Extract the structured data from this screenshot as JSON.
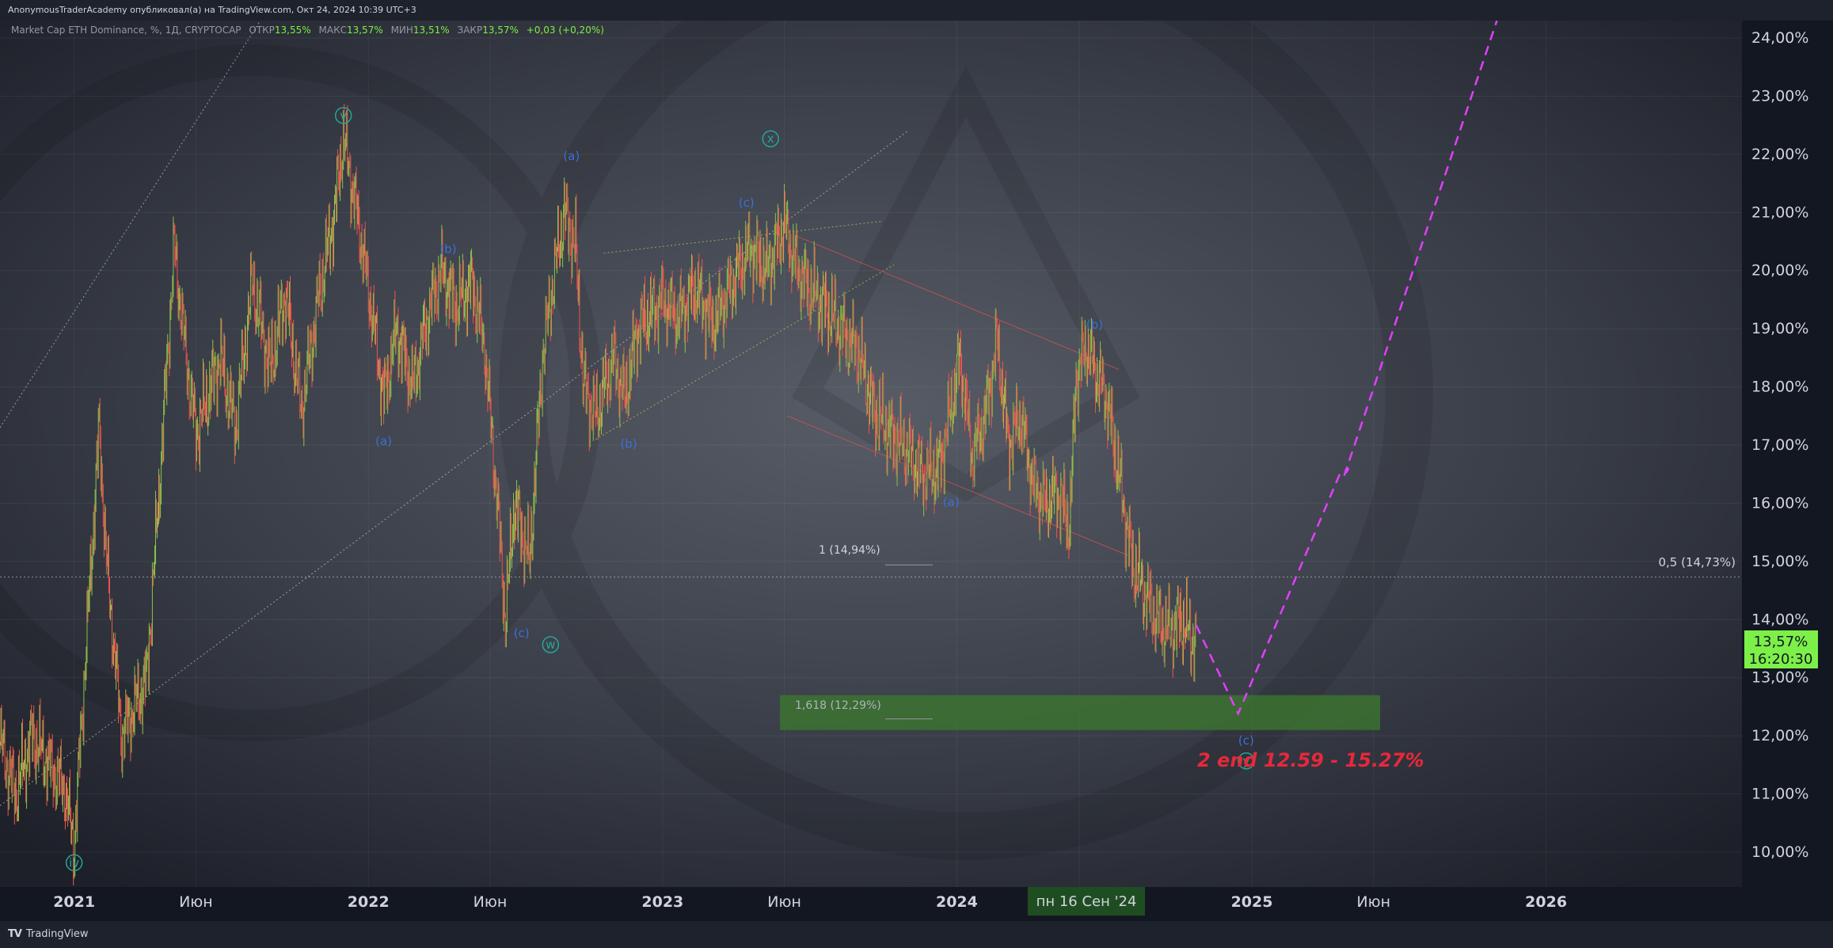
{
  "header": {
    "text": "AnonymousTraderAcademy опубликовал(а) на TradingView.com, Окт 24, 2024 10:39 UTC+3"
  },
  "legend": {
    "symbol": "Market Cap ETH Dominance, %, 1Д, CRYPTOCAP",
    "open_label": "ОТКР",
    "open_value": "13,55%",
    "high_label": "МАКС",
    "high_value": "13,57%",
    "low_label": "МИН",
    "low_value": "13,51%",
    "close_label": "ЗАКР",
    "close_value": "13,57%",
    "change": "+0,03 (+0,20%)"
  },
  "price_tag": {
    "value": "13,57%",
    "countdown": "16:20:30"
  },
  "crosshair_date": "пн 16 Сен '24",
  "fib_levels": [
    {
      "label": "1 (14,94%)",
      "value": 14.94
    },
    {
      "label": "1,618 (12,29%)",
      "value": 12.29
    },
    {
      "label": "0,5 (14,73%)",
      "value": 14.73
    }
  ],
  "target_zone": {
    "low": 12.1,
    "high": 12.7
  },
  "annotation": "2 end 12.59 - 15.27%",
  "wave_labels": [
    {
      "text": "v",
      "x": "2021-12-01",
      "y": 22.6,
      "circle": true,
      "color": "#26a69a"
    },
    {
      "text": "iv",
      "x": "2021-01-01",
      "y": 9.75,
      "circle": true,
      "color": "#26a69a"
    },
    {
      "text": "w",
      "x": "2022-08-15",
      "y": 13.5,
      "circle": true,
      "color": "#26a69a"
    },
    {
      "text": "x",
      "x": "2023-05-15",
      "y": 22.2,
      "circle": true,
      "color": "#26a69a"
    },
    {
      "text": "y",
      "x": "2024-12-25",
      "y": 11.5,
      "circle": true,
      "color": "#26a69a"
    },
    {
      "text": "(a)",
      "x": "2022-01-20",
      "y": 17.0,
      "circle": false,
      "color": "#3c6fd6"
    },
    {
      "text": "(b)",
      "x": "2022-04-10",
      "y": 20.3,
      "circle": false,
      "color": "#3c6fd6"
    },
    {
      "text": "(c)",
      "x": "2022-07-10",
      "y": 13.7,
      "circle": false,
      "color": "#3c6fd6"
    },
    {
      "text": "(a)",
      "x": "2022-09-10",
      "y": 21.9,
      "circle": false,
      "color": "#3c6fd6"
    },
    {
      "text": "(b)",
      "x": "2022-11-20",
      "y": 16.95,
      "circle": false,
      "color": "#3c6fd6"
    },
    {
      "text": "(c)",
      "x": "2023-04-15",
      "y": 21.1,
      "circle": false,
      "color": "#3c6fd6"
    },
    {
      "text": "(a)",
      "x": "2023-12-25",
      "y": 15.95,
      "circle": false,
      "color": "#3c6fd6"
    },
    {
      "text": "(b)",
      "x": "2024-06-20",
      "y": 19.0,
      "circle": false,
      "color": "#3c6fd6"
    },
    {
      "text": "(c)",
      "x": "2024-12-25",
      "y": 11.85,
      "circle": false,
      "color": "#3c6fd6"
    }
  ],
  "chart_data": {
    "type": "candlestick",
    "title": "Market Cap ETH Dominance, %, 1Д, CRYPTOCAP",
    "ylim": [
      9.4,
      24.3
    ],
    "xlim": [
      "2020-10-01",
      "2026-09-01"
    ],
    "y_ticks": [
      "10,00%",
      "11,00%",
      "12,00%",
      "13,00%",
      "14,00%",
      "15,00%",
      "16,00%",
      "17,00%",
      "18,00%",
      "19,00%",
      "20,00%",
      "21,00%",
      "22,00%",
      "23,00%",
      "24,00%"
    ],
    "x_ticks": [
      {
        "label": "2021",
        "x": "2021-01-01"
      },
      {
        "label": "Июн",
        "x": "2021-06-01"
      },
      {
        "label": "2022",
        "x": "2022-01-01"
      },
      {
        "label": "Июн",
        "x": "2022-06-01"
      },
      {
        "label": "2023",
        "x": "2023-01-01"
      },
      {
        "label": "Июн",
        "x": "2023-06-01"
      },
      {
        "label": "2024",
        "x": "2024-01-01"
      },
      {
        "label": "Июн",
        "x": "2024-06-01"
      },
      {
        "label": "2025",
        "x": "2025-01-01"
      },
      {
        "label": "Июн",
        "x": "2025-06-01"
      },
      {
        "label": "2026",
        "x": "2026-01-01"
      }
    ],
    "price_path": [
      [
        "2020-10-01",
        11.9
      ],
      [
        "2020-10-20",
        11.0
      ],
      [
        "2020-11-10",
        12.0
      ],
      [
        "2020-12-01",
        11.5
      ],
      [
        "2020-12-20",
        11.1
      ],
      [
        "2021-01-01",
        10.1
      ],
      [
        "2021-01-20",
        14.5
      ],
      [
        "2021-02-01",
        17.3
      ],
      [
        "2021-02-10",
        15.0
      ],
      [
        "2021-03-01",
        12.0
      ],
      [
        "2021-03-20",
        12.6
      ],
      [
        "2021-04-01",
        13.0
      ],
      [
        "2021-04-20",
        17.0
      ],
      [
        "2021-05-05",
        20.4
      ],
      [
        "2021-05-20",
        18.5
      ],
      [
        "2021-06-01",
        17.2
      ],
      [
        "2021-07-01",
        18.5
      ],
      [
        "2021-07-20",
        17.3
      ],
      [
        "2021-08-10",
        19.8
      ],
      [
        "2021-09-01",
        18.3
      ],
      [
        "2021-09-20",
        19.6
      ],
      [
        "2021-10-10",
        17.6
      ],
      [
        "2021-11-01",
        19.6
      ],
      [
        "2021-11-20",
        21.0
      ],
      [
        "2021-12-01",
        22.3
      ],
      [
        "2021-12-20",
        20.8
      ],
      [
        "2022-01-05",
        19.3
      ],
      [
        "2022-01-20",
        17.8
      ],
      [
        "2022-02-05",
        19.0
      ],
      [
        "2022-02-25",
        18.0
      ],
      [
        "2022-03-15",
        19.2
      ],
      [
        "2022-04-01",
        20.0
      ],
      [
        "2022-04-20",
        19.4
      ],
      [
        "2022-05-10",
        19.8
      ],
      [
        "2022-05-25",
        18.7
      ],
      [
        "2022-06-10",
        16.0
      ],
      [
        "2022-06-20",
        14.0
      ],
      [
        "2022-07-01",
        16.0
      ],
      [
        "2022-07-20",
        15.0
      ],
      [
        "2022-08-05",
        18.5
      ],
      [
        "2022-08-20",
        20.0
      ],
      [
        "2022-09-01",
        21.0
      ],
      [
        "2022-09-15",
        20.4
      ],
      [
        "2022-09-25",
        18.0
      ],
      [
        "2022-10-10",
        17.5
      ],
      [
        "2022-11-01",
        18.5
      ],
      [
        "2022-11-15",
        17.8
      ],
      [
        "2022-12-01",
        19.0
      ],
      [
        "2023-01-01",
        19.5
      ],
      [
        "2023-01-20",
        19.2
      ],
      [
        "2023-02-10",
        19.7
      ],
      [
        "2023-03-05",
        19.1
      ],
      [
        "2023-04-01",
        19.9
      ],
      [
        "2023-04-20",
        20.4
      ],
      [
        "2023-05-10",
        20.0
      ],
      [
        "2023-06-01",
        20.8
      ],
      [
        "2023-06-15",
        20.1
      ],
      [
        "2023-07-01",
        19.7
      ],
      [
        "2023-07-20",
        19.4
      ],
      [
        "2023-08-10",
        19.0
      ],
      [
        "2023-09-01",
        18.6
      ],
      [
        "2023-09-20",
        17.6
      ],
      [
        "2023-10-10",
        17.2
      ],
      [
        "2023-11-01",
        16.9
      ],
      [
        "2023-11-20",
        16.5
      ],
      [
        "2023-12-10",
        16.6
      ],
      [
        "2023-12-20",
        17.3
      ],
      [
        "2024-01-05",
        18.5
      ],
      [
        "2024-01-20",
        16.8
      ],
      [
        "2024-02-05",
        17.5
      ],
      [
        "2024-02-20",
        18.8
      ],
      [
        "2024-03-05",
        17.0
      ],
      [
        "2024-03-20",
        17.5
      ],
      [
        "2024-04-05",
        16.3
      ],
      [
        "2024-04-20",
        16.0
      ],
      [
        "2024-05-05",
        16.2
      ],
      [
        "2024-05-20",
        15.6
      ],
      [
        "2024-05-28",
        18.2
      ],
      [
        "2024-06-10",
        18.7
      ],
      [
        "2024-06-20",
        18.3
      ],
      [
        "2024-07-05",
        17.8
      ],
      [
        "2024-07-20",
        16.5
      ],
      [
        "2024-08-05",
        15.0
      ],
      [
        "2024-08-20",
        14.5
      ],
      [
        "2024-09-05",
        14.0
      ],
      [
        "2024-09-20",
        13.8
      ],
      [
        "2024-10-05",
        14.0
      ],
      [
        "2024-10-24",
        13.57
      ]
    ],
    "projection": [
      [
        "2024-10-24",
        13.9
      ],
      [
        "2024-12-15",
        12.38
      ],
      [
        "2025-04-20",
        16.5
      ],
      [
        "2025-05-01",
        16.6
      ],
      [
        "2025-04-25",
        16.45
      ],
      [
        "2025-11-01",
        24.3
      ]
    ]
  },
  "footer": {
    "logo": "TV",
    "brand": "TradingView"
  },
  "colors": {
    "background": "#131722",
    "grid": "#2a2e39",
    "up": "#8bc34a",
    "down": "#ef5350",
    "price_tag": "#7cf048",
    "projection": "#e040fb",
    "annotation": "#e8283a",
    "zone": "#3c7a2e",
    "teal": "#26a69a",
    "blue": "#3c6fd6"
  }
}
